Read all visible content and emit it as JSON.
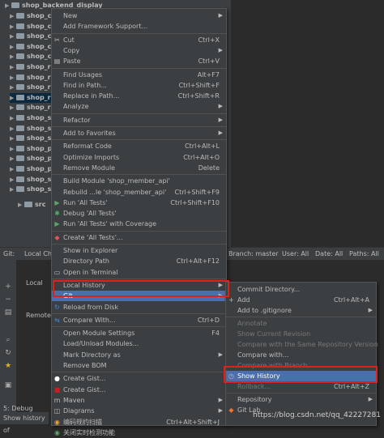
{
  "tree": {
    "root": "shop_backend_display",
    "rows": [
      "shop_c",
      "shop_c",
      "shop_c",
      "shop_c",
      "shop_c",
      "shop_r",
      "shop_r",
      "shop_r",
      "shop_r",
      "shop_r",
      "shop_s",
      "shop_s",
      "shop_s",
      "shop_p",
      "shop_p",
      "shop_p",
      "shop_s",
      "shop_s"
    ],
    "src": "src"
  },
  "git": {
    "header_label": "Git:",
    "local_changes_tab": "Local Cha",
    "local_label": "Local",
    "remote_label": "Remote",
    "branch_filter": "Branch: master",
    "user_filter": "User: All",
    "date_filter": "Date: All",
    "paths_filter": "Paths: All"
  },
  "status": {
    "debug_label": "5: Debug",
    "history_label": "Show history of"
  },
  "context_menu": [
    {
      "label": "New",
      "shortcut": "",
      "submenu": true
    },
    {
      "label": "Add Framework Support...",
      "shortcut": ""
    },
    {
      "sep": true
    },
    {
      "label": "Cut",
      "shortcut": "Ctrl+X",
      "icon": "cut-icon"
    },
    {
      "label": "Copy",
      "shortcut": "",
      "submenu": true
    },
    {
      "label": "Paste",
      "shortcut": "Ctrl+V",
      "icon": "paste-icon"
    },
    {
      "sep": true
    },
    {
      "label": "Find Usages",
      "shortcut": "Alt+F7"
    },
    {
      "label": "Find in Path...",
      "shortcut": "Ctrl+Shift+F"
    },
    {
      "label": "Replace in Path...",
      "shortcut": "Ctrl+Shift+R"
    },
    {
      "label": "Analyze",
      "shortcut": "",
      "submenu": true
    },
    {
      "sep": true
    },
    {
      "label": "Refactor",
      "shortcut": "",
      "submenu": true
    },
    {
      "sep": true
    },
    {
      "label": "Add to Favorites",
      "shortcut": "",
      "submenu": true
    },
    {
      "sep": true
    },
    {
      "label": "Reformat Code",
      "shortcut": "Ctrl+Alt+L"
    },
    {
      "label": "Optimize Imports",
      "shortcut": "Ctrl+Alt+O"
    },
    {
      "label": "Remove Module",
      "shortcut": "Delete"
    },
    {
      "sep": true
    },
    {
      "label": "Build Module 'shop_member_api'",
      "shortcut": ""
    },
    {
      "label": "Rebuild ...le 'shop_member_api'",
      "shortcut": "Ctrl+Shift+F9"
    },
    {
      "label": "Run 'All Tests'",
      "shortcut": "Ctrl+Shift+F10",
      "icon": "run-icon"
    },
    {
      "label": "Debug 'All Tests'",
      "shortcut": "",
      "icon": "debug-icon"
    },
    {
      "label": "Run 'All Tests' with Coverage",
      "shortcut": "",
      "icon": "coverage-icon"
    },
    {
      "sep": true
    },
    {
      "label": "Create 'All Tests'...",
      "shortcut": "",
      "icon": "test-icon"
    },
    {
      "sep": true
    },
    {
      "label": "Show in Explorer",
      "shortcut": ""
    },
    {
      "label": "Directory Path",
      "shortcut": "Ctrl+Alt+F12"
    },
    {
      "label": "Open in Terminal",
      "shortcut": "",
      "icon": "terminal-icon"
    },
    {
      "sep": true
    },
    {
      "label": "Local History",
      "shortcut": "",
      "submenu": true
    },
    {
      "label": "Git",
      "shortcut": "",
      "submenu": true,
      "highlight": true
    },
    {
      "label": "Reload from Disk",
      "shortcut": "",
      "icon": "reload-icon"
    },
    {
      "sep": true
    },
    {
      "label": "Compare With...",
      "shortcut": "Ctrl+D",
      "icon": "compare-icon"
    },
    {
      "sep": true
    },
    {
      "label": "Open Module Settings",
      "shortcut": "F4"
    },
    {
      "label": "Load/Unload Modules...",
      "shortcut": ""
    },
    {
      "label": "Mark Directory as",
      "shortcut": "",
      "submenu": true
    },
    {
      "label": "Remove BOM",
      "shortcut": ""
    },
    {
      "sep": true
    },
    {
      "label": "Create Gist...",
      "shortcut": "",
      "icon": "github-icon"
    },
    {
      "label": "Create Gist...",
      "shortcut": "",
      "icon": "gitee-icon"
    },
    {
      "label": "Maven",
      "shortcut": "",
      "submenu": true,
      "icon": "maven-icon"
    },
    {
      "label": "Diagrams",
      "shortcut": "",
      "submenu": true,
      "icon": "diagrams-icon"
    },
    {
      "label": "编码规约扫描",
      "shortcut": "Ctrl+Alt+Shift+J",
      "icon": "scan-icon"
    },
    {
      "label": "关闭实时检测功能",
      "shortcut": "",
      "icon": "realtime-icon"
    }
  ],
  "git_submenu": [
    {
      "label": "Commit Directory...",
      "shortcut": ""
    },
    {
      "label": "Add",
      "shortcut": "Ctrl+Alt+A",
      "icon": "add-icon"
    },
    {
      "label": "Add to .gitignore",
      "shortcut": "",
      "submenu": true
    },
    {
      "sep": true
    },
    {
      "label": "Annotate",
      "shortcut": "",
      "disabled": true
    },
    {
      "label": "Show Current Revision",
      "shortcut": "",
      "disabled": true
    },
    {
      "label": "Compare with the Same Repository Version",
      "shortcut": "",
      "disabled": true
    },
    {
      "label": "Compare with...",
      "shortcut": ""
    },
    {
      "label": "Compare with Branch...",
      "shortcut": "",
      "disabled": true
    },
    {
      "label": "Show History",
      "shortcut": "",
      "highlight": true,
      "icon": "clock-icon"
    },
    {
      "label": "Rollback...",
      "shortcut": "Ctrl+Alt+Z",
      "disabled": true
    },
    {
      "sep": true
    },
    {
      "label": "Repository",
      "shortcut": "",
      "submenu": true
    },
    {
      "label": "Git Lab",
      "shortcut": "",
      "icon": "gitlab-icon"
    }
  ],
  "watermark": "https://blog.csdn.net/qq_42227281",
  "colors": {
    "highlight": "#4b6eaf",
    "redbox": "#e0201c",
    "menu_bg": "#3c3f41"
  }
}
